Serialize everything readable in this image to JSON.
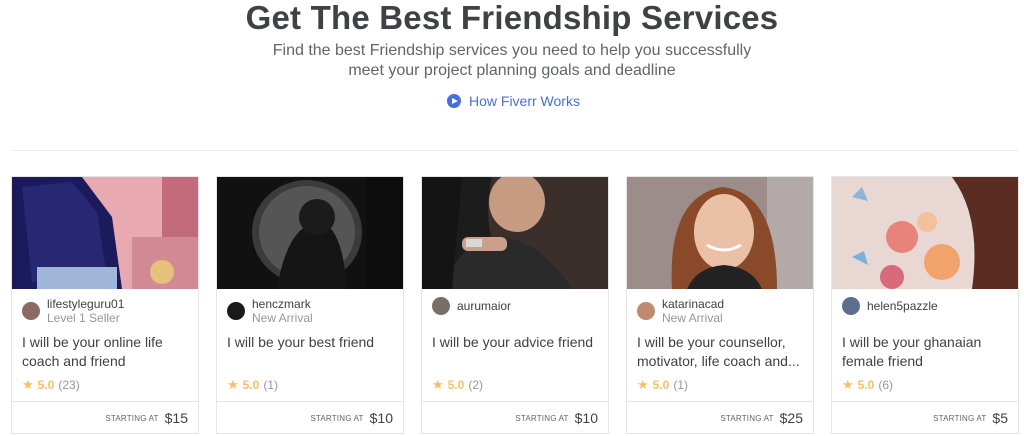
{
  "hero": {
    "title": "Get The Best Friendship Services",
    "subtitle": "Find the best Friendship services you need to help you successfully meet your project planning goals and deadline",
    "how_link": "How Fiverr Works"
  },
  "colors": {
    "accent": "#446ee7",
    "star": "#ffbe5b",
    "text": "#404145",
    "muted": "#95979d"
  },
  "cards": [
    {
      "username": "lifestyleguru01",
      "level": "Level 1 Seller",
      "title": "I will be your online life coach and friend",
      "rating": "5.0",
      "count": "(23)",
      "starting": "STARTING AT",
      "price": "$15",
      "avatar_color": "#8a6a63"
    },
    {
      "username": "henczmark",
      "level": "New Arrival",
      "title": "I will be your best friend",
      "rating": "5.0",
      "count": "(1)",
      "starting": "STARTING AT",
      "price": "$10",
      "avatar_color": "#1a1a1a"
    },
    {
      "username": "aurumaior",
      "level": "",
      "title": "I will be your advice friend",
      "rating": "5.0",
      "count": "(2)",
      "starting": "STARTING AT",
      "price": "$10",
      "avatar_color": "#7b6e66"
    },
    {
      "username": "katarinacad",
      "level": "New Arrival",
      "title": "I will be your counsellor, motivator, life coach and...",
      "rating": "5.0",
      "count": "(1)",
      "starting": "STARTING AT",
      "price": "$25",
      "avatar_color": "#c08a6e"
    },
    {
      "username": "helen5pazzle",
      "level": "",
      "title": "I will be your ghanaian female friend",
      "rating": "5.0",
      "count": "(6)",
      "starting": "STARTING AT",
      "price": "$5",
      "avatar_color": "#5c6f8c"
    }
  ]
}
